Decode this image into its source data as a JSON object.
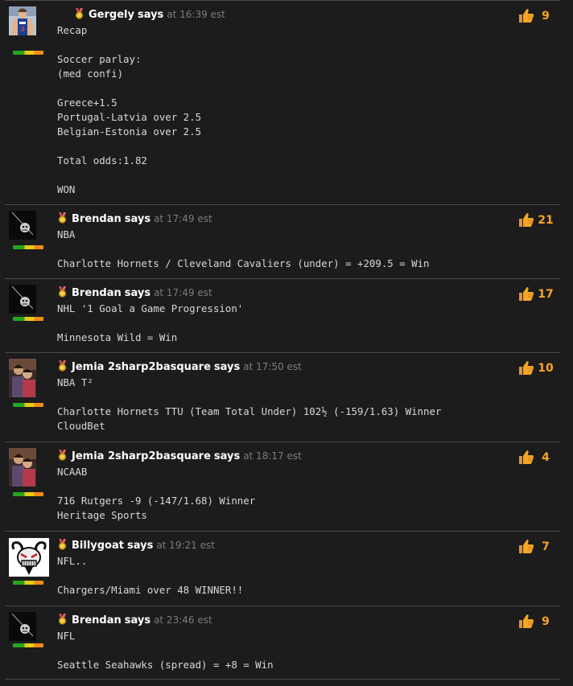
{
  "comments": [
    {
      "author": "Gergely",
      "says": "says",
      "time": "at 16:39 est",
      "likes": "9",
      "avatar": "player-photo",
      "body": "Recap\n\nSoccer parlay:\n(med confi)\n\nGreece+1.5\nPortugal-Latvia over 2.5\nBelgian-Estonia over 2.5\n\nTotal odds:1.82\n\nWON"
    },
    {
      "author": "Brendan",
      "says": "says",
      "time": "at 17:49 est",
      "likes": "21",
      "avatar": "dark-photo",
      "body": "NBA\n\nCharlotte Hornets / Cleveland Cavaliers (under) = +209.5 = Win"
    },
    {
      "author": "Brendan",
      "says": "says",
      "time": "at 17:49 est",
      "likes": "17",
      "avatar": "dark-photo",
      "body": "NHL '1 Goal a Game Progression'\n\nMinnesota Wild = Win"
    },
    {
      "author": "Jemia 2sharp2basquare",
      "says": "says",
      "time": "at 17:50 est",
      "likes": "10",
      "avatar": "couple-photo",
      "body": "NBA T²\n\nCharlotte Hornets TTU (Team Total Under) 102½ (-159/1.63) Winner\nCloudBet"
    },
    {
      "author": "Jemia 2sharp2basquare",
      "says": "says",
      "time": "at 18:17 est",
      "likes": "4",
      "avatar": "couple-photo",
      "body": "NCAAB\n\n716 Rutgers -9 (-147/1.68) Winner\nHeritage Sports"
    },
    {
      "author": "Billygoat",
      "says": "says",
      "time": "at 19:21 est",
      "likes": "7",
      "avatar": "goat-cartoon",
      "body": "NFL..\n\nChargers/Miami over 48 WINNER!!"
    },
    {
      "author": "Brendan",
      "says": "says",
      "time": "at 23:46 est",
      "likes": "9",
      "avatar": "dark-photo",
      "body": "NFL\n\nSeattle Seahawks (spread) = +8 = Win"
    }
  ],
  "icons": {
    "badge": "medal-badge-icon",
    "like": "thumbs-up-icon"
  },
  "colors": {
    "background": "#1c1c1c",
    "author": "#ffffff",
    "time": "#7c7c7c",
    "likes": "#f5a623"
  }
}
